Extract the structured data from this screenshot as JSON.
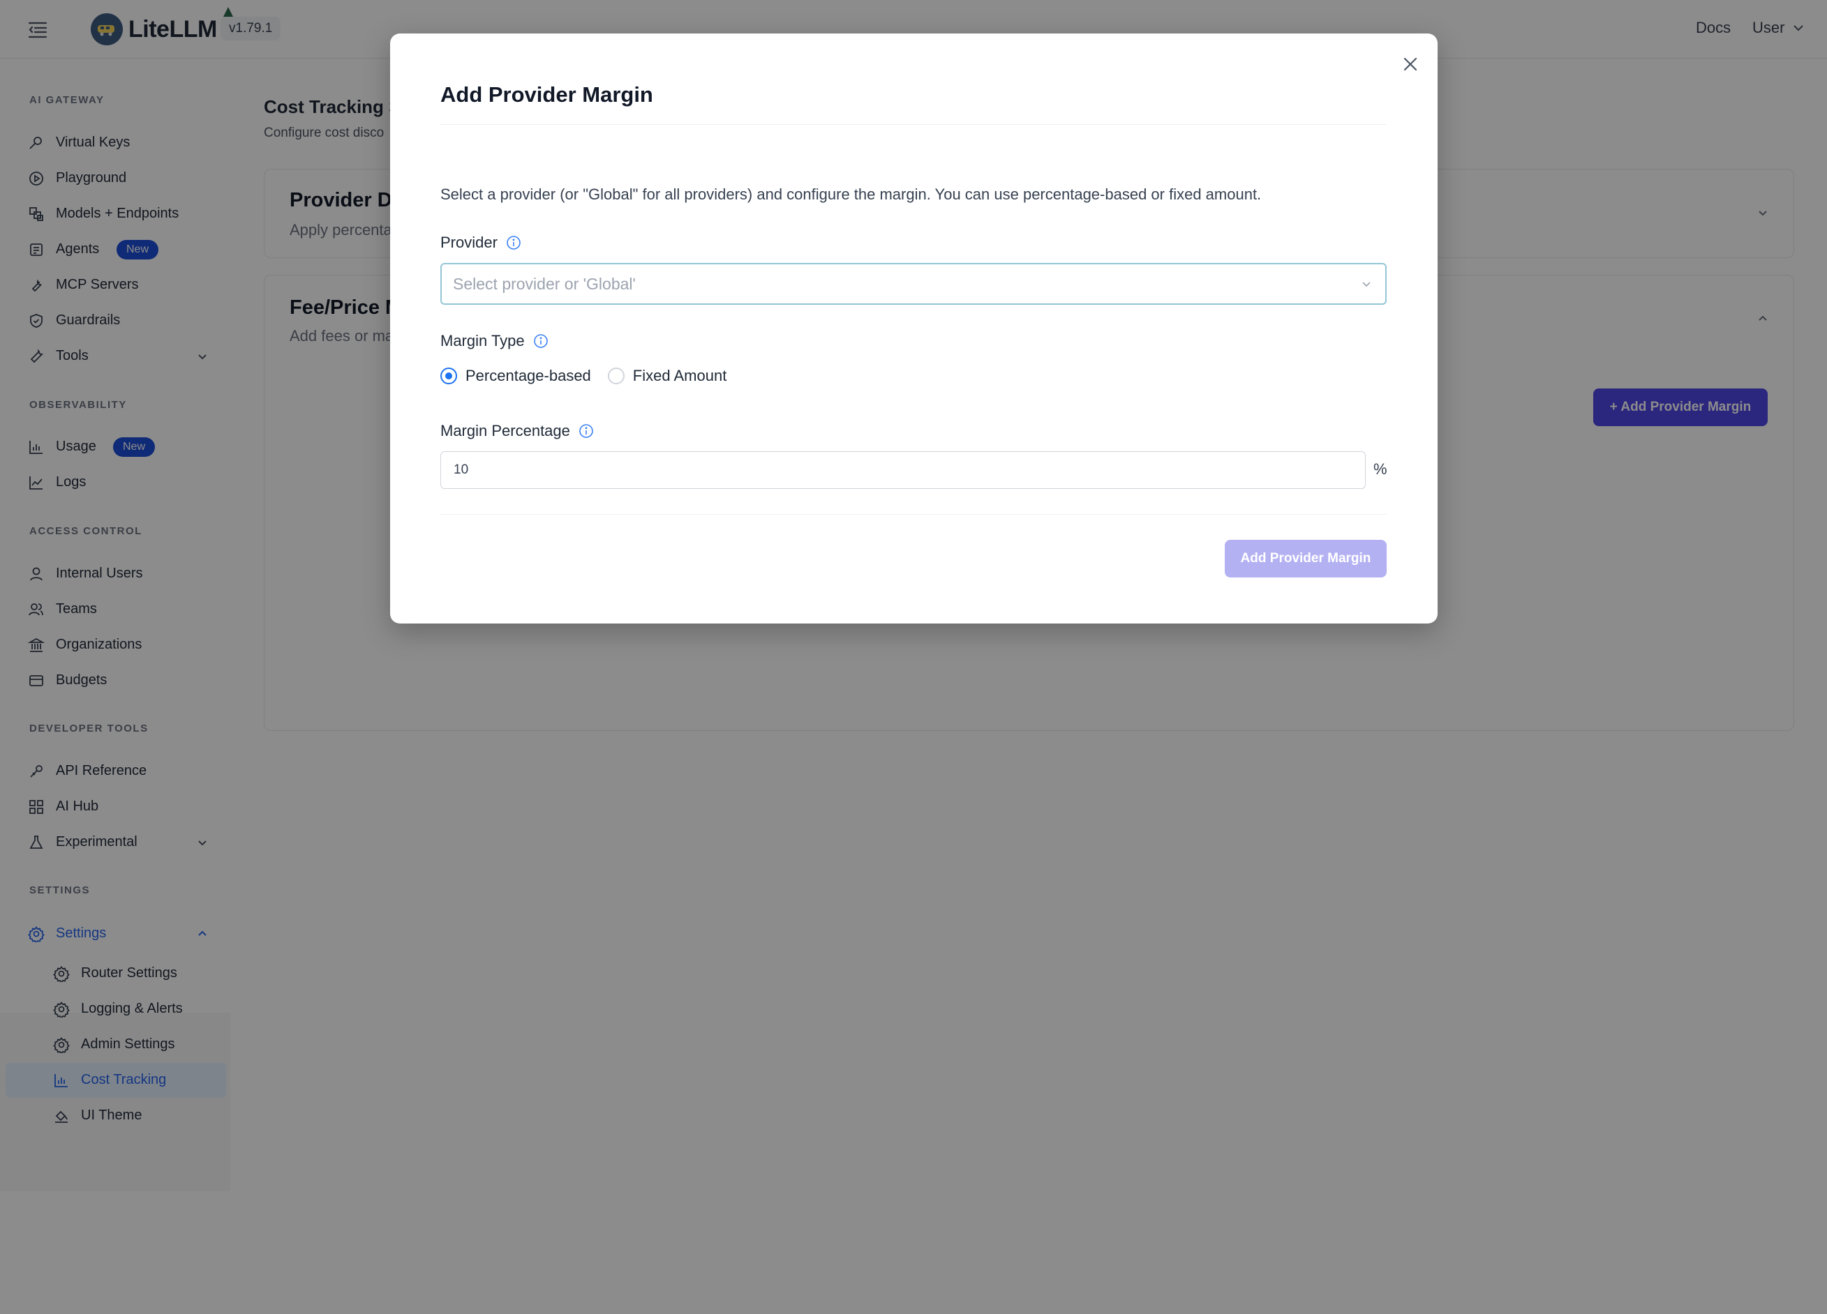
{
  "header": {
    "app_name": "LiteLLM",
    "version": "v1.79.1",
    "docs_label": "Docs",
    "user_label": "User"
  },
  "sidebar": {
    "sections": {
      "ai_gateway": "AI GATEWAY",
      "observability": "OBSERVABILITY",
      "access_control": "ACCESS CONTROL",
      "developer_tools": "DEVELOPER TOOLS",
      "settings": "SETTINGS"
    },
    "items": {
      "virtual_keys": "Virtual Keys",
      "playground": "Playground",
      "models": "Models + Endpoints",
      "agents": "Agents",
      "agents_badge": "New",
      "mcp_servers": "MCP Servers",
      "guardrails": "Guardrails",
      "tools": "Tools",
      "usage": "Usage",
      "usage_badge": "New",
      "logs": "Logs",
      "internal_users": "Internal Users",
      "teams": "Teams",
      "organizations": "Organizations",
      "budgets": "Budgets",
      "api_reference": "API Reference",
      "ai_hub": "AI Hub",
      "experimental": "Experimental",
      "settings": "Settings",
      "router_settings": "Router Settings",
      "logging_alerts": "Logging & Alerts",
      "admin_settings": "Admin Settings",
      "cost_tracking": "Cost Tracking",
      "ui_theme": "UI Theme"
    }
  },
  "main": {
    "title_visible": "Cost Tracking S",
    "subtitle_visible": "Configure cost disco",
    "card1_title_visible": "Provider Di",
    "card1_sub_visible": "Apply percenta",
    "card2_title_visible": "Fee/Price M",
    "card2_sub_visible": "Add fees or ma",
    "add_button": "+ Add Provider Margin"
  },
  "modal": {
    "title": "Add Provider Margin",
    "description": "Select a provider (or \"Global\" for all providers) and configure the margin. You can use percentage-based or fixed amount.",
    "provider_label": "Provider",
    "provider_placeholder": "Select provider or 'Global'",
    "margin_type_label": "Margin Type",
    "option_percentage": "Percentage-based",
    "option_fixed": "Fixed Amount",
    "selected_option": "Percentage-based",
    "margin_percentage_label": "Margin Percentage",
    "margin_percentage_value": "10",
    "suffix": "%",
    "submit_label": "Add Provider Margin"
  }
}
